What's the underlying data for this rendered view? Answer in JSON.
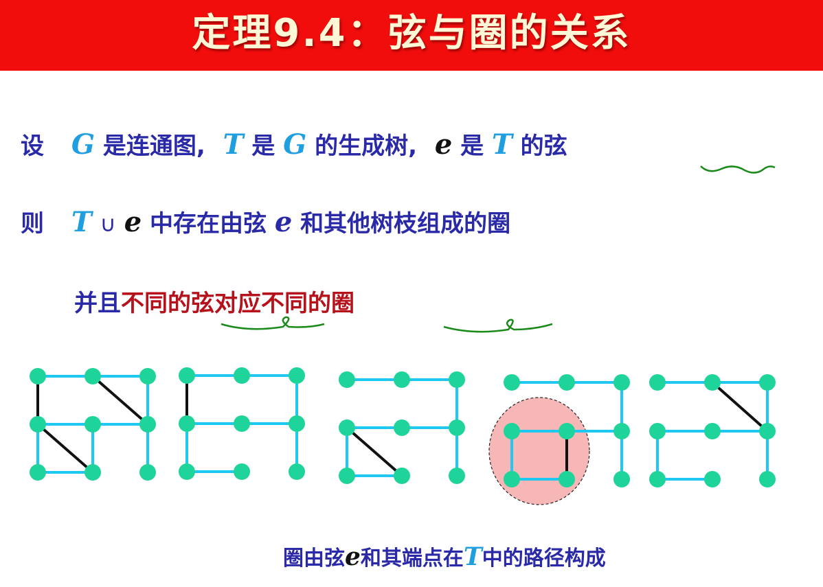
{
  "title": "定理9.4：弦与圈的关系",
  "line1": {
    "lead": "设",
    "G1": "G",
    "t1": "是连通图,",
    "T1": "T",
    "t2": "是",
    "G2": "G",
    "t3": "的生成树,",
    "e1": "e",
    "t4": "是",
    "T2": "T",
    "t5": "的弦"
  },
  "line2": {
    "lead": "则",
    "T": "T",
    "cup": "∪",
    "e1": "e",
    "t1": "中存在由弦",
    "e2": "e",
    "t2": "和其他树枝组成的圈"
  },
  "line3": {
    "blue": "并且",
    "red": "不同的弦对应不同的圈"
  },
  "footer": {
    "t1": "圈由弦",
    "e": "e",
    "t2": "和其端点在",
    "T": "T",
    "t3": "中的路径构成"
  },
  "colors": {
    "title_bg": "#f20d0d",
    "text_blue": "#2a2aa8",
    "symbol_blue": "#1f9fe0",
    "emphasis_red": "#b5121b",
    "tree_edge": "#1ec8f0",
    "vertex": "#1fd49a",
    "chord": "#111111",
    "annotation_green": "#1a8a1a",
    "highlight_fill": "#f7b7b7"
  }
}
